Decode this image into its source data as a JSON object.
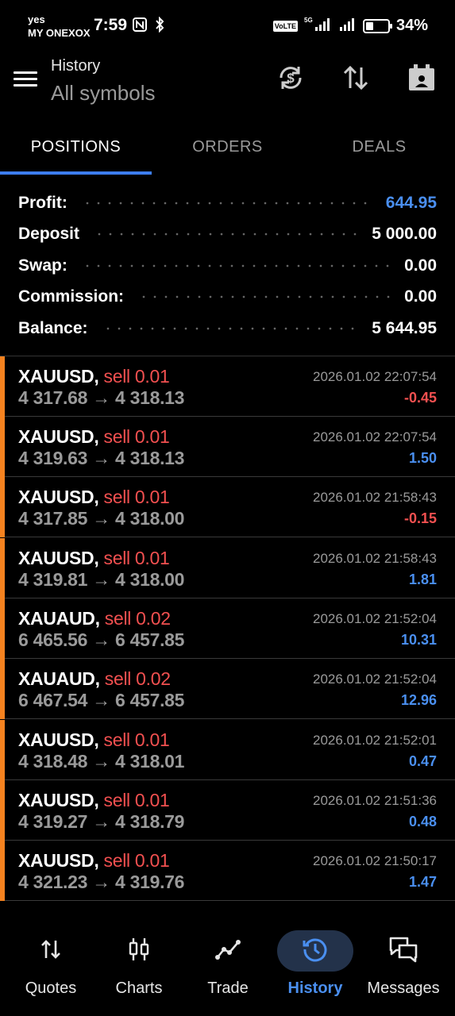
{
  "status_bar": {
    "carrier_line1": "yes",
    "carrier_line2": "MY ONEXOX",
    "time": "7:59",
    "volte": "VoLTE",
    "net": "5G",
    "battery": "34%",
    "battery_level": 0.34
  },
  "header": {
    "title": "History",
    "subtitle": "All symbols"
  },
  "tabs": [
    {
      "label": "POSITIONS",
      "active": true
    },
    {
      "label": "ORDERS",
      "active": false
    },
    {
      "label": "DEALS",
      "active": false
    }
  ],
  "summary": [
    {
      "label": "Profit:",
      "value": "644.95",
      "highlight": true
    },
    {
      "label": "Deposit",
      "value": "5 000.00",
      "highlight": false
    },
    {
      "label": "Swap:",
      "value": "0.00",
      "highlight": false
    },
    {
      "label": "Commission:",
      "value": "0.00",
      "highlight": false
    },
    {
      "label": "Balance:",
      "value": "5 644.95",
      "highlight": false
    }
  ],
  "positions": [
    {
      "symbol": "XAUUSD,",
      "side": "sell 0.01",
      "prices": "4 317.68 → 4 318.13",
      "time": "2026.01.02 22:07:54",
      "profit": "-0.45",
      "negative": true
    },
    {
      "symbol": "XAUUSD,",
      "side": "sell 0.01",
      "prices": "4 319.63 → 4 318.13",
      "time": "2026.01.02 22:07:54",
      "profit": "1.50",
      "negative": false
    },
    {
      "symbol": "XAUUSD,",
      "side": "sell 0.01",
      "prices": "4 317.85 → 4 318.00",
      "time": "2026.01.02 21:58:43",
      "profit": "-0.15",
      "negative": true
    },
    {
      "symbol": "XAUUSD,",
      "side": "sell 0.01",
      "prices": "4 319.81 → 4 318.00",
      "time": "2026.01.02 21:58:43",
      "profit": "1.81",
      "negative": false
    },
    {
      "symbol": "XAUAUD,",
      "side": "sell 0.02",
      "prices": "6 465.56 → 6 457.85",
      "time": "2026.01.02 21:52:04",
      "profit": "10.31",
      "negative": false
    },
    {
      "symbol": "XAUAUD,",
      "side": "sell 0.02",
      "prices": "6 467.54 → 6 457.85",
      "time": "2026.01.02 21:52:04",
      "profit": "12.96",
      "negative": false
    },
    {
      "symbol": "XAUUSD,",
      "side": "sell 0.01",
      "prices": "4 318.48 → 4 318.01",
      "time": "2026.01.02 21:52:01",
      "profit": "0.47",
      "negative": false
    },
    {
      "symbol": "XAUUSD,",
      "side": "sell 0.01",
      "prices": "4 319.27 → 4 318.79",
      "time": "2026.01.02 21:51:36",
      "profit": "0.48",
      "negative": false
    },
    {
      "symbol": "XAUUSD,",
      "side": "sell 0.01",
      "prices": "4 321.23 → 4 319.76",
      "time": "2026.01.02 21:50:17",
      "profit": "1.47",
      "negative": false
    }
  ],
  "bottom_nav": [
    {
      "label": "Quotes",
      "icon": "quotes-icon",
      "active": false
    },
    {
      "label": "Charts",
      "icon": "charts-icon",
      "active": false
    },
    {
      "label": "Trade",
      "icon": "trade-icon",
      "active": false
    },
    {
      "label": "History",
      "icon": "history-icon",
      "active": true
    },
    {
      "label": "Messages",
      "icon": "messages-icon",
      "active": false
    }
  ],
  "colors": {
    "accent": "#4a8ff0",
    "loss": "#f25050",
    "position_bar": "#f5821f",
    "background": "#000000"
  }
}
